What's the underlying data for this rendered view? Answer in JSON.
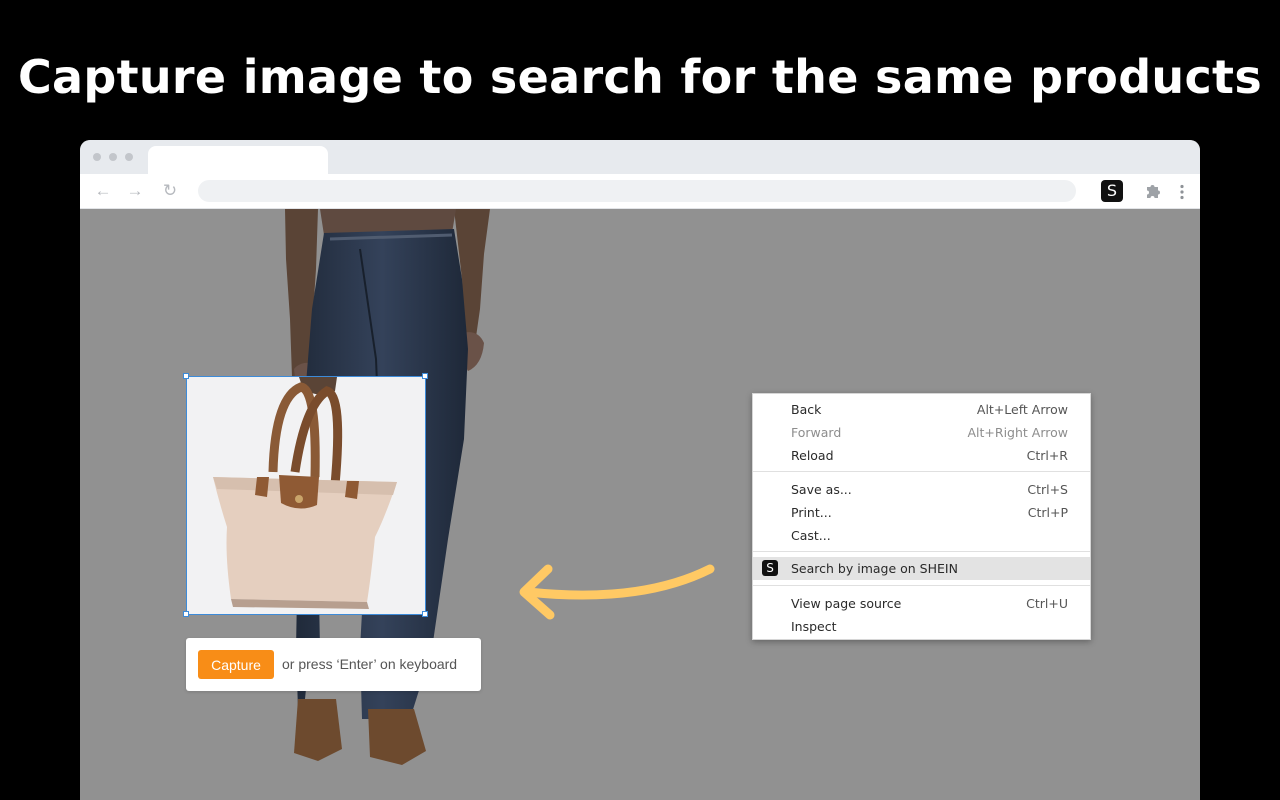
{
  "headline": "Capture image to search for the same products",
  "browser": {
    "nav": {
      "back_icon": "←",
      "forward_icon": "→",
      "reload_icon": "↻"
    },
    "extension_icon_letter": "S",
    "icons": [
      "arrow-left-icon",
      "arrow-right-icon",
      "reload-icon",
      "shein-s-icon",
      "puzzle-icon",
      "kebab-menu-icon"
    ]
  },
  "capture": {
    "button_label": "Capture",
    "hint": "or press ‘Enter’ on keyboard"
  },
  "context_menu": {
    "items": [
      {
        "label": "Back",
        "shortcut": "Alt+Left Arrow"
      },
      {
        "label": "Forward",
        "shortcut": "Alt+Right Arrow",
        "disabled": true
      },
      {
        "label": "Reload",
        "shortcut": "Ctrl+R"
      },
      {
        "label": "Save as...",
        "shortcut": "Ctrl+S"
      },
      {
        "label": "Print...",
        "shortcut": "Ctrl+P"
      },
      {
        "label": "Cast...",
        "shortcut": ""
      },
      {
        "label": "Search by image on SHEIN",
        "shortcut": "",
        "highlighted": true,
        "icon_letter": "S"
      },
      {
        "label": "View page source",
        "shortcut": "Ctrl+U"
      },
      {
        "label": "Inspect",
        "shortcut": ""
      }
    ]
  },
  "colors": {
    "capture_button": "#f88d17",
    "arrow": "#ffc964",
    "selection_border": "#3d8bd9",
    "page_overlay": "#919191"
  }
}
